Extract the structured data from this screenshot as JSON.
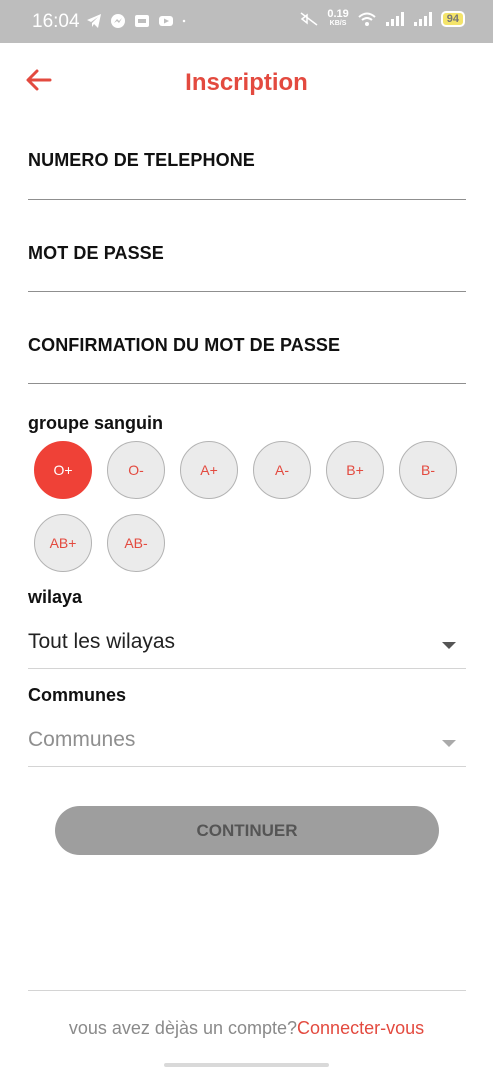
{
  "status_bar": {
    "time": "16:04",
    "net_speed": "0.19",
    "net_unit": "KB/S",
    "battery": "94",
    "icons": [
      "telegram-icon",
      "messenger-icon",
      "gallery-icon",
      "youtube-icon",
      "dot-icon",
      "mute-icon",
      "wifi-icon",
      "signal-icon",
      "signal-icon",
      "battery-icon"
    ]
  },
  "header": {
    "title": "Inscription",
    "back_icon": "arrow-left-icon"
  },
  "form": {
    "phone_label": "NUMERO DE TELEPHONE",
    "password_label": "MOT DE PASSE",
    "confirm_label": "CONFIRMATION DU MOT DE PASSE"
  },
  "blood": {
    "label": "groupe sanguin",
    "selected": "O+",
    "groups": [
      "O+",
      "O-",
      "A+",
      "A-",
      "B+",
      "B-",
      "AB+",
      "AB-"
    ]
  },
  "wilaya": {
    "label": "wilaya",
    "value": "Tout les wilayas"
  },
  "communes": {
    "label": "Communes",
    "placeholder": "Communes"
  },
  "continue_label": "CONTINUER",
  "footer": {
    "text": "vous avez dèjàs un compte?",
    "link": "Connecter-vous"
  },
  "colors": {
    "accent": "#e34a3f",
    "selected_group": "#ef4137",
    "button_disabled": "#9e9e9e"
  }
}
